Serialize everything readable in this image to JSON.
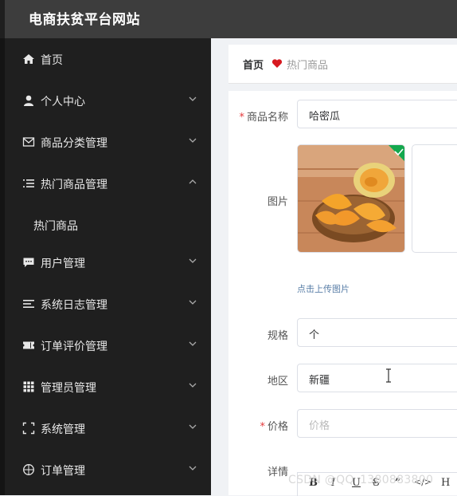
{
  "app": {
    "title": "电商扶贫平台网站"
  },
  "sidebar": {
    "items": [
      {
        "label": "首页",
        "icon": "home-icon",
        "expandable": false
      },
      {
        "label": "个人中心",
        "icon": "user-icon",
        "expandable": true
      },
      {
        "label": "商品分类管理",
        "icon": "mail-icon",
        "expandable": true
      },
      {
        "label": "热门商品管理",
        "icon": "list-icon",
        "expandable": true,
        "expanded": true
      },
      {
        "label": "热门商品",
        "sub": true
      },
      {
        "label": "用户管理",
        "icon": "chat-icon",
        "expandable": true
      },
      {
        "label": "系统日志管理",
        "icon": "lines-icon",
        "expandable": true
      },
      {
        "label": "订单评价管理",
        "icon": "ticket-icon",
        "expandable": true
      },
      {
        "label": "管理员管理",
        "icon": "grid-icon",
        "expandable": true
      },
      {
        "label": "系统管理",
        "icon": "frame-icon",
        "expandable": true
      },
      {
        "label": "订单管理",
        "icon": "compass-icon",
        "expandable": true
      }
    ]
  },
  "breadcrumb": {
    "home": "首页",
    "current": "热门商品"
  },
  "form": {
    "name_label": "商品名称",
    "name_value": "哈密瓜",
    "image_label": "图片",
    "upload_tip": "点击上传图片",
    "spec_label": "规格",
    "spec_value": "个",
    "region_label": "地区",
    "region_value": "新疆",
    "price_label": "价格",
    "price_placeholder": "价格",
    "detail_label": "详情",
    "required_mark": "*"
  },
  "editor": {
    "tools": [
      "B",
      "I",
      "U",
      "S",
      "”",
      "</>",
      "H"
    ]
  },
  "watermark": "CSDN @QQ_1380883800",
  "colors": {
    "sidebar_bg": "#1f1f1f",
    "topbar_bg": "#3d3d3d",
    "accent_heart": "#d71920",
    "required": "#e4393c",
    "check_badge": "#13a84e"
  }
}
